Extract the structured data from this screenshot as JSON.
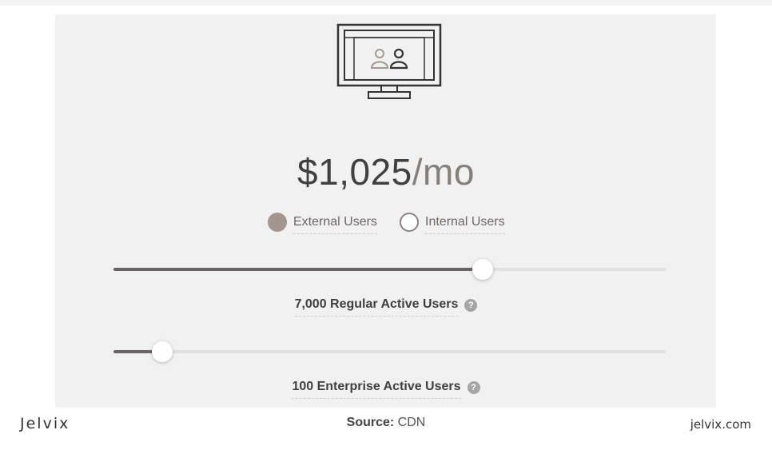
{
  "pricing": {
    "price_amount": "$1,025",
    "price_unit": "/mo"
  },
  "user_type": {
    "options": [
      {
        "label": "External Users",
        "selected": true
      },
      {
        "label": "Internal Users",
        "selected": false
      }
    ]
  },
  "regular_users": {
    "label": "7,000 Regular Active Users",
    "slider_fraction": 0.668
  },
  "enterprise_users": {
    "label": "100 Enterprise Active Users",
    "slider_fraction": 0.088
  },
  "help_icon": "question-mark-icon",
  "footer": {
    "brand": "Jelvix",
    "source_label": "Source:",
    "source_value": "CDN",
    "site": "jelvix.com"
  },
  "colors": {
    "panel_bg": "#f1f1f1",
    "selected_radio": "#a39590",
    "slider_fill": "#6a6462",
    "price_text": "#404040",
    "price_unit": "#857f7c"
  }
}
